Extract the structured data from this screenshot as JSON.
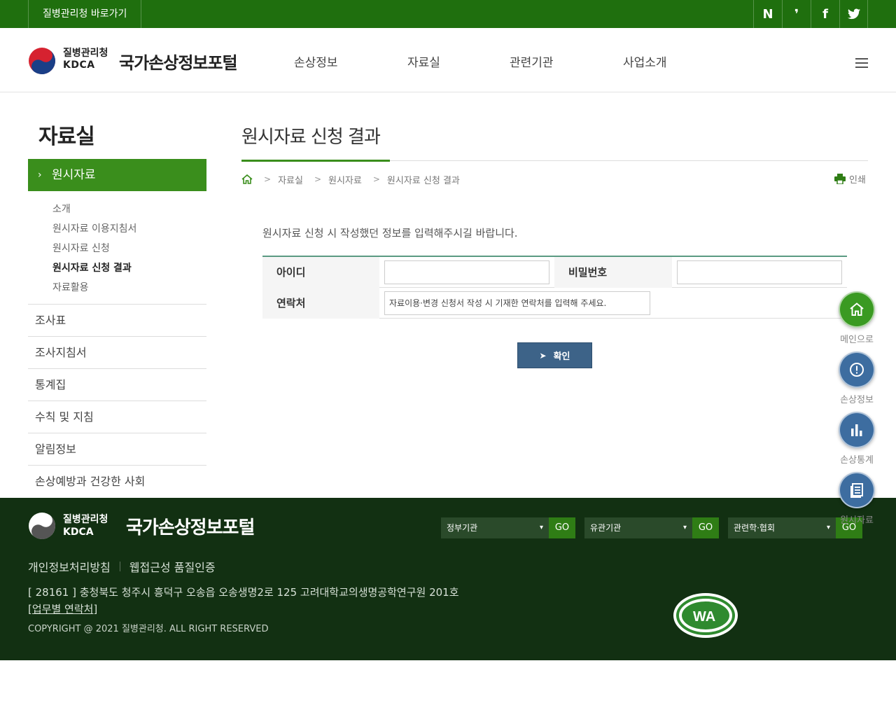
{
  "topbar": {
    "shortcut_label": "질병관리청 바로가기",
    "social": [
      "N",
      "❜",
      "f",
      "twitter"
    ]
  },
  "header": {
    "org_name": "질병관리청",
    "org_abbr": "KDCA",
    "site_title": "국가손상정보포털",
    "nav": [
      "손상정보",
      "자료실",
      "관련기관",
      "사업소개"
    ]
  },
  "sidebar": {
    "title": "자료실",
    "active": "원시자료",
    "sub_items": [
      "소개",
      "원시자료 이용지침서",
      "원시자료 신청",
      "원시자료 신청 결과",
      "자료활용"
    ],
    "current_sub": "원시자료 신청 결과",
    "items": [
      "조사표",
      "조사지침서",
      "통계집",
      "수칙 및 지침",
      "알림정보",
      "손상예방과 건강한 사회"
    ]
  },
  "main": {
    "page_title": "원시자료 신청 결과",
    "breadcrumb": [
      "자료실",
      "원시자료",
      "원시자료 신청 결과"
    ],
    "print_label": "인쇄",
    "guide_text": "원시자료 신청 시 작성했던 정보를 입력해주시길 바랍니다.",
    "form": {
      "id_label": "아이디",
      "id_value": "",
      "password_label": "비밀번호",
      "password_value": "",
      "contact_label": "연락처",
      "contact_placeholder": "자료이용·변경 신청서 작성 시 기재한 연락처를 입력해 주세요."
    },
    "confirm_label": "확인"
  },
  "quick_menu": [
    {
      "label": "메인으로",
      "icon": "home-icon",
      "color": "#3a9a22"
    },
    {
      "label": "손상정보",
      "icon": "info-icon",
      "color": "#3d6da0"
    },
    {
      "label": "손상통계",
      "icon": "bar-chart-icon",
      "color": "#3d6da0"
    },
    {
      "label": "원시자료",
      "icon": "document-icon",
      "color": "#3d6da0"
    }
  ],
  "footer": {
    "org_name": "질병관리청",
    "org_abbr": "KDCA",
    "site_title": "국가손상정보포털",
    "links": [
      "개인정보처리방침",
      "웹접근성 품질인증"
    ],
    "address": "[ 28161 ] 충청북도 청주시 흥덕구 오송읍 오송생명2로 125 고려대학교의생명공학연구원 201호",
    "contact_link": "[업무별 연락처]",
    "copyright": "COPYRIGHT @ 2021 질병관리청. ALL RIGHT RESERVED",
    "selects": [
      {
        "label": "정부기관",
        "go": "GO"
      },
      {
        "label": "유관기관",
        "go": "GO"
      },
      {
        "label": "관련학·협회",
        "go": "GO"
      }
    ],
    "badge_text": "WA"
  },
  "colors": {
    "brand_green": "#1f6f0e",
    "active_green": "#3a8e1c",
    "footer_bg": "#123012",
    "button_blue": "#3d6388"
  }
}
